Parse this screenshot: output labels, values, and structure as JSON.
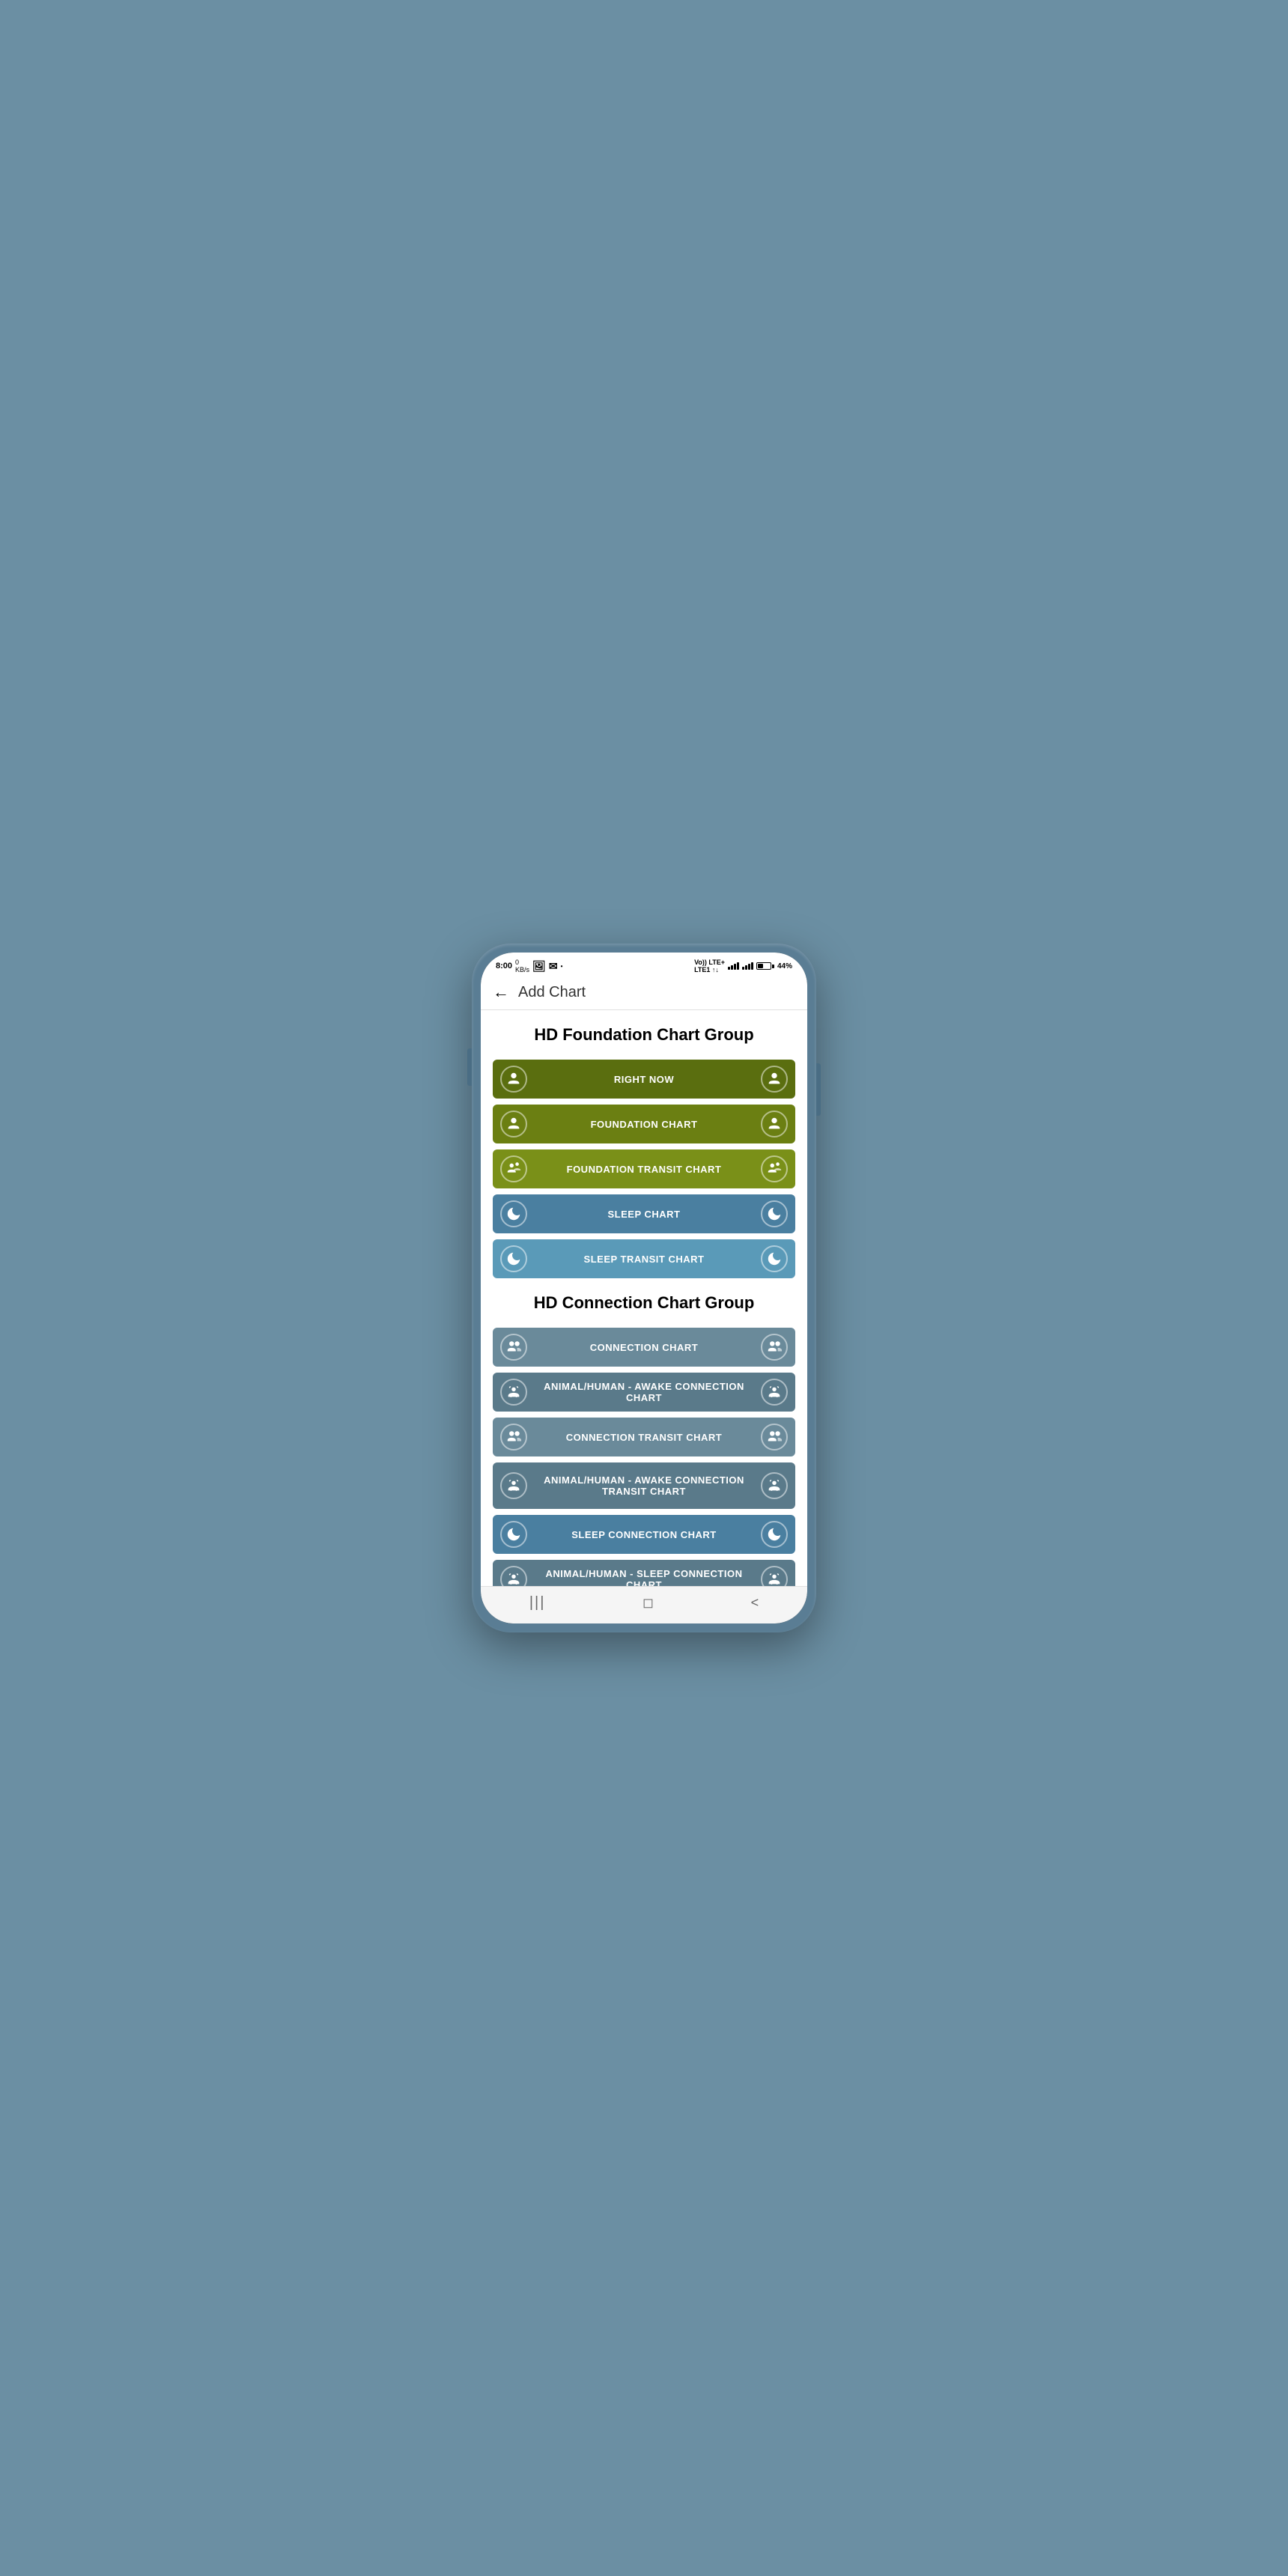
{
  "app": {
    "title": "Add Chart",
    "back_label": "←"
  },
  "status_bar": {
    "time": "8:00",
    "network": "Vo)) LTE+",
    "battery": "44%"
  },
  "foundation_group": {
    "title": "HD Foundation Chart Group",
    "buttons": [
      {
        "id": "right-now",
        "label": "RIGHT NOW",
        "color_class": "btn-dark-green",
        "icon": "person"
      },
      {
        "id": "foundation-chart",
        "label": "FOUNDATION CHART",
        "color_class": "btn-medium-green",
        "icon": "person"
      },
      {
        "id": "foundation-transit-chart",
        "label": "FOUNDATION TRANSIT CHART",
        "color_class": "btn-light-green",
        "icon": "person-transit"
      },
      {
        "id": "sleep-chart",
        "label": "SLEEP CHART",
        "color_class": "btn-teal",
        "icon": "sleep"
      },
      {
        "id": "sleep-transit-chart",
        "label": "SLEEP TRANSIT CHART",
        "color_class": "btn-light-teal",
        "icon": "sleep"
      }
    ]
  },
  "connection_group": {
    "title": "HD Connection Chart Group",
    "buttons": [
      {
        "id": "connection-chart",
        "label": "CONNECTION CHART",
        "color_class": "btn-grey",
        "icon": "people"
      },
      {
        "id": "animal-awake-connection",
        "label": "ANIMAL/HUMAN - AWAKE CONNECTION CHART",
        "color_class": "btn-medium-grey",
        "icon": "animal"
      },
      {
        "id": "connection-transit",
        "label": "CONNECTION TRANSIT CHART",
        "color_class": "btn-grey",
        "icon": "people"
      },
      {
        "id": "animal-awake-connection-transit",
        "label": "ANIMAL/HUMAN - AWAKE CONNECTION TRANSIT CHART",
        "color_class": "btn-medium-grey",
        "icon": "animal"
      },
      {
        "id": "sleep-connection-chart",
        "label": "SLEEP CONNECTION CHART",
        "color_class": "btn-teal",
        "icon": "sleep"
      },
      {
        "id": "animal-sleep-connection",
        "label": "ANIMAL/HUMAN - SLEEP CONNECTION CHART",
        "color_class": "btn-medium-grey",
        "icon": "animal"
      }
    ]
  },
  "bottom_nav": {
    "items": [
      "|||",
      "◻",
      "<"
    ]
  }
}
